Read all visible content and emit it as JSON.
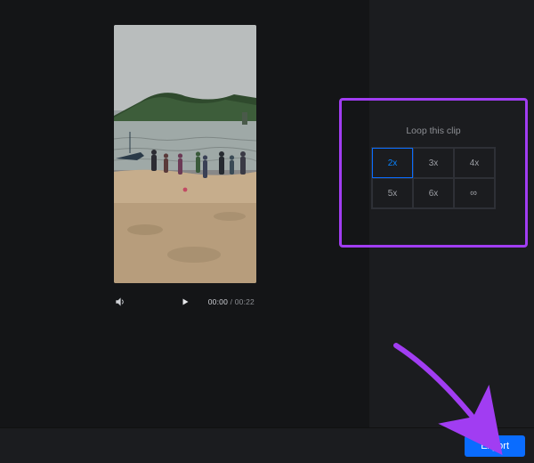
{
  "colors": {
    "accent": "#0a6cff",
    "highlight": "#a13df2"
  },
  "preview": {
    "current_time": "00:00",
    "duration": "00:22"
  },
  "loop_panel": {
    "title": "Loop this clip",
    "options": [
      "2x",
      "3x",
      "4x",
      "5x",
      "6x",
      "∞"
    ],
    "selected_index": 0
  },
  "bottom": {
    "export_label": "Export"
  }
}
